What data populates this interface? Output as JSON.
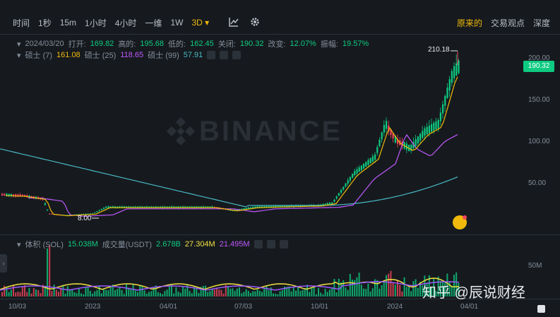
{
  "toolbar": {
    "items": [
      "时间",
      "1秒",
      "15m",
      "1小时",
      "4小时",
      "一维",
      "1W",
      "3D"
    ],
    "active_index": 7,
    "right_items": [
      "原来的",
      "交易观点",
      "深度"
    ]
  },
  "info": {
    "date": "2024/03/20",
    "open_label": "打开:",
    "open": "169.82",
    "high_label": "高的:",
    "high": "195.68",
    "low_label": "低的:",
    "low": "162.45",
    "close_label": "关闭:",
    "close": "190.32",
    "change_label": "改变:",
    "change": "12.07%",
    "amplitude_label": "振幅:",
    "amplitude": "19.57%"
  },
  "ma": {
    "ma7_label": "硕士 (7)",
    "ma7": "161.08",
    "ma25_label": "硕士 (25)",
    "ma25": "118.65",
    "ma99_label": "硕士 (99)",
    "ma99": "57.91"
  },
  "volume": {
    "label": "体积 (SOL)",
    "sol": "15.038M",
    "usdt_label": "成交量(USDT)",
    "usdt": "2.678B",
    "ma1": "27.304M",
    "ma2": "21.495M",
    "axis_label": "50M"
  },
  "yaxis": [
    "200.00",
    "150.00",
    "100.00",
    "50.00"
  ],
  "price_tag": "190.32",
  "high_marker": "210.18",
  "low_marker": "8.00",
  "xaxis": [
    "10/03",
    "2023",
    "04/01",
    "07/03",
    "10/01",
    "2024",
    "04/01"
  ],
  "watermark": "BINANCE",
  "footer_watermark": "知乎 @辰说财经",
  "colors": {
    "up": "#0ecb81",
    "down": "#f6465d",
    "ma7": "#f0b90b",
    "ma25": "#c158ff",
    "ma99": "#48b9c7",
    "bg": "#161a1e"
  }
}
